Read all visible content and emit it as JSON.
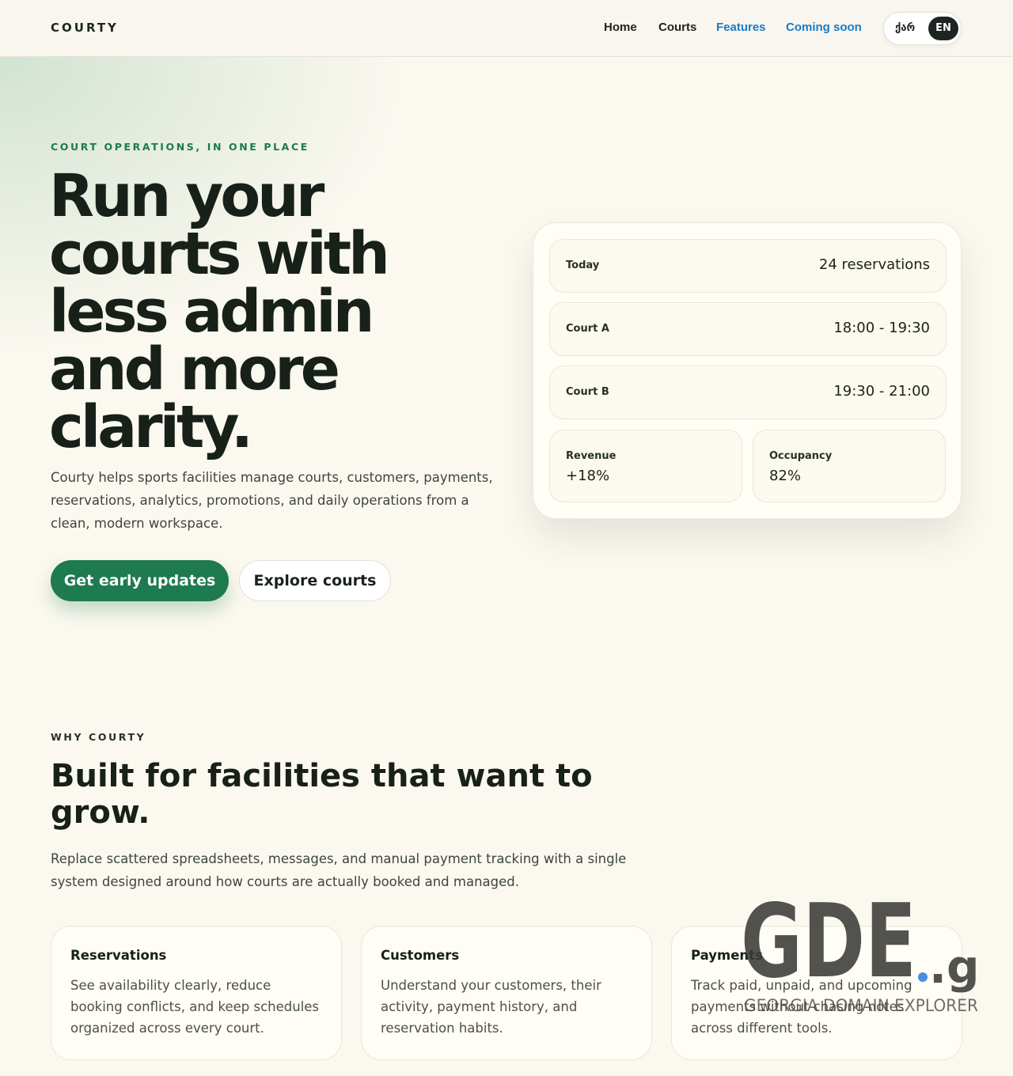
{
  "brand": {
    "logo_text": "COURTY"
  },
  "nav": {
    "items": [
      {
        "label": "Home"
      },
      {
        "label": "Courts"
      },
      {
        "label": "Features"
      },
      {
        "label": "Coming soon"
      }
    ],
    "lang": {
      "ka": "ქარ",
      "en": "EN",
      "selected": "EN"
    }
  },
  "hero": {
    "eyebrow": "COURT OPERATIONS, IN ONE PLACE",
    "title": "Run your courts with less admin and more clarity.",
    "description": "Courty helps sports facilities manage courts, customers, payments, reservations, analytics, promotions, and daily operations from a clean, modern workspace.",
    "primary_cta": "Get early updates",
    "secondary_cta": "Explore courts"
  },
  "dashboard": {
    "rows": [
      {
        "label": "Today",
        "value": "24 reservations"
      },
      {
        "label": "Court A",
        "value": "18:00 - 19:30"
      },
      {
        "label": "Court B",
        "value": "19:30 - 21:00"
      }
    ],
    "stats": [
      {
        "label": "Revenue",
        "value": "+18%"
      },
      {
        "label": "Occupancy",
        "value": "82%"
      }
    ]
  },
  "why": {
    "eyebrow": "WHY COURTY",
    "title": "Built for facilities that want to grow.",
    "description": "Replace scattered spreadsheets, messages, and manual payment tracking with a single system designed around how courts are actually booked and managed.",
    "features": [
      {
        "title": "Reservations",
        "description": "See availability clearly, reduce booking conflicts, and keep schedules organized across every court."
      },
      {
        "title": "Customers",
        "description": "Understand your customers, their activity, payment history, and reservation habits."
      },
      {
        "title": "Payments",
        "description": "Track paid, unpaid, and upcoming payments without chasing notes across different tools."
      }
    ]
  },
  "watermark": {
    "brand": "GDE",
    "tld": ".ge",
    "tagline": "GEORGIA DOMAIN EXPLORER"
  },
  "colors": {
    "background": "#fbf8f0",
    "accent_green": "#1e7a4f",
    "link_blue": "#1a7bc4",
    "dark": "#172019"
  }
}
